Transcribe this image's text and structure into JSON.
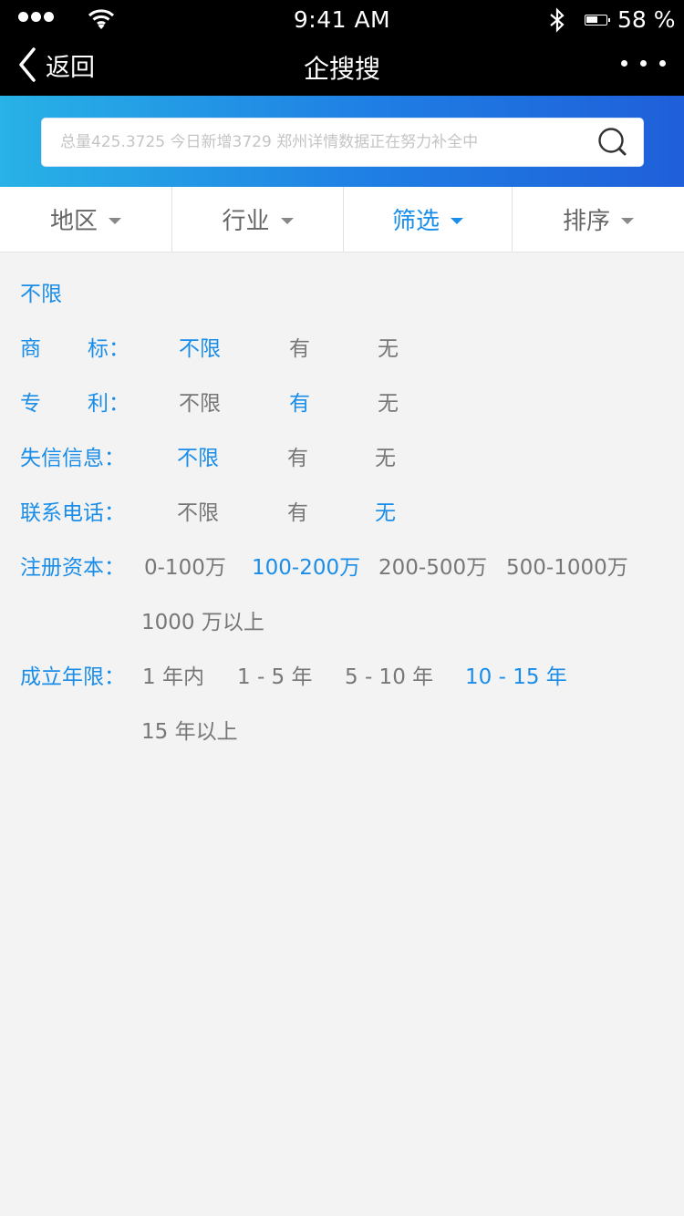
{
  "status_bar": {
    "time": "9:41 AM",
    "battery": "58 %"
  },
  "nav": {
    "back_label": "返回",
    "title": "企搜搜",
    "more_icon": "more-dots-icon"
  },
  "search": {
    "placeholder": "总量425.3725 今日新增3729 郑州详情数据正在努力补全中"
  },
  "tabs": [
    {
      "label": "地区",
      "active": false
    },
    {
      "label": "行业",
      "active": false
    },
    {
      "label": "筛选",
      "active": true
    },
    {
      "label": "排序",
      "active": false
    }
  ],
  "filters": {
    "unlimited_all": "不限",
    "trademark": {
      "label_a": "商",
      "label_b": "标：",
      "options": [
        "不限",
        "有",
        "无"
      ],
      "selected": 0
    },
    "patent": {
      "label_a": "专",
      "label_b": "利：",
      "options": [
        "不限",
        "有",
        "无"
      ],
      "selected": 1
    },
    "dishonest": {
      "label": "失信信息：",
      "options": [
        "不限",
        "有",
        "无"
      ],
      "selected": 0
    },
    "phone": {
      "label": "联系电话：",
      "options": [
        "不限",
        "有",
        "无"
      ],
      "selected": 2
    },
    "capital": {
      "label": "注册资本：",
      "options": [
        "0-100万",
        "100-200万",
        "200-500万",
        "500-1000万",
        "1000 万以上"
      ],
      "selected": 1
    },
    "years": {
      "label": "成立年限：",
      "options": [
        "1 年内",
        "1 - 5 年",
        "5 - 10 年",
        "10 - 15 年",
        "15 年以上"
      ],
      "selected": 3
    }
  },
  "colors": {
    "accent": "#1a8de9",
    "header_bg": "#000000",
    "gradient_start": "#28b2e6",
    "gradient_end": "#1f5fd9"
  }
}
